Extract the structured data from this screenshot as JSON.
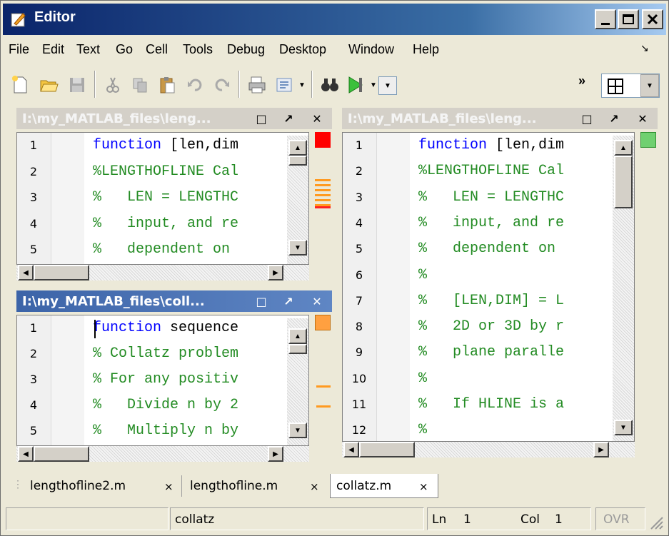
{
  "window": {
    "title": "Editor",
    "controls": [
      "_",
      "□",
      "X"
    ]
  },
  "menu": {
    "items": [
      {
        "label": "File"
      },
      {
        "label": "Edit"
      },
      {
        "label": "Text"
      },
      {
        "label": "Go"
      },
      {
        "label": "Cell"
      },
      {
        "label": "Tools"
      },
      {
        "label": "Debug"
      },
      {
        "label": "Desktop"
      },
      {
        "label": "Window"
      },
      {
        "label": "Help"
      }
    ],
    "dock_arrow": "↘"
  },
  "toolbar": {
    "overflow": "»",
    "layout_icon": "grid-icon"
  },
  "panes": {
    "top_left": {
      "title": "I:\\my_MATLAB_files\\leng...",
      "btn_min": "□",
      "btn_undock": "↗",
      "btn_close": "✕",
      "lines": [
        {
          "n": "1",
          "kw": "function",
          "rest": " [len,dim"
        },
        {
          "n": "2",
          "rest": "%LENGTHOFLINE Cal"
        },
        {
          "n": "3",
          "rest": "%   LEN = LENGTHC"
        },
        {
          "n": "4",
          "rest": "%   input, and re"
        },
        {
          "n": "5",
          "rest": "%   dependent on"
        }
      ],
      "marker_color": "#ff0000"
    },
    "bottom_left": {
      "title": "I:\\my_MATLAB_files\\coll...",
      "btn_min": "□",
      "btn_undock": "↗",
      "btn_close": "✕",
      "lines": [
        {
          "n": "1",
          "kw": "function",
          "rest": " sequence"
        },
        {
          "n": "2",
          "rest": "% Collatz problem"
        },
        {
          "n": "3",
          "rest": "% For any positiv"
        },
        {
          "n": "4",
          "rest": "%   Divide n by 2"
        },
        {
          "n": "5",
          "rest": "%   Multiply n by"
        }
      ],
      "marker_color": "#ffa040"
    },
    "right": {
      "title": "I:\\my_MATLAB_files\\leng...",
      "btn_min": "□",
      "btn_undock": "↗",
      "btn_close": "✕",
      "lines": [
        {
          "n": "1",
          "kw": "function",
          "rest": " [len,dim"
        },
        {
          "n": "2",
          "rest": "%LENGTHOFLINE Cal"
        },
        {
          "n": "3",
          "rest": "%   LEN = LENGTHC"
        },
        {
          "n": "4",
          "rest": "%   input, and re"
        },
        {
          "n": "5",
          "rest": "%   dependent on"
        },
        {
          "n": "6",
          "rest": "%"
        },
        {
          "n": "7",
          "rest": "%   [LEN,DIM] = L"
        },
        {
          "n": "8",
          "rest": "%   2D or 3D by r"
        },
        {
          "n": "9",
          "rest": "%   plane paralle"
        },
        {
          "n": "10",
          "rest": "%"
        },
        {
          "n": "11",
          "rest": "%   If HLINE is a"
        },
        {
          "n": "12",
          "rest": "%"
        }
      ],
      "marker_color": "#70d070"
    }
  },
  "tabs": [
    {
      "label": "lengthofline2.m",
      "close": "×"
    },
    {
      "label": "lengthofline.m",
      "close": "×"
    },
    {
      "label": "collatz.m",
      "close": "×",
      "active": true
    }
  ],
  "status": {
    "function": "collatz",
    "ln_label": "Ln",
    "ln_value": "1",
    "col_label": "Col",
    "col_value": "1",
    "ovr": "OVR"
  }
}
